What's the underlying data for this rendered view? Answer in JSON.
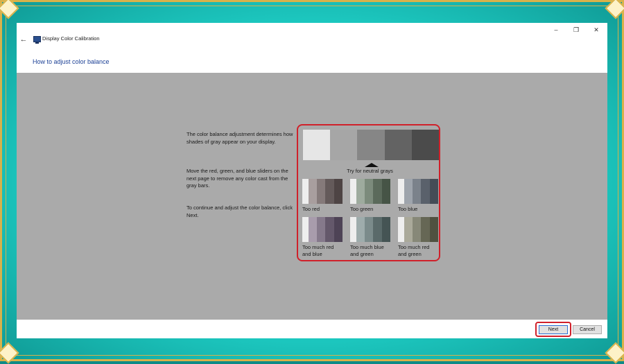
{
  "window": {
    "title": "Display Color Calibration",
    "back_icon": "back-arrow-icon",
    "controls": {
      "minimize": "–",
      "maximize": "❐",
      "close": "✕"
    }
  },
  "page": {
    "heading": "How to adjust color balance",
    "paragraphs": [
      "The color balance adjustment determines how shades of gray appear on your display.",
      "Move the red, green, and blue sliders on the next page to remove any color cast from the gray bars.",
      "To continue and adjust the color balance, click Next."
    ]
  },
  "samples": {
    "neutral_label": "Try for neutral grays",
    "neutral_colors": [
      "#e6e6e6",
      "#a6a6a6",
      "#868686",
      "#636363",
      "#4b4b4b"
    ],
    "items": [
      {
        "label": "Too red",
        "colors": [
          "#eeeeee",
          "#a89e9e",
          "#857a7a",
          "#645a5a",
          "#4e4444"
        ]
      },
      {
        "label": "Too green",
        "colors": [
          "#eeeeee",
          "#9eab9e",
          "#7c8b7c",
          "#5b6a5b",
          "#465446"
        ]
      },
      {
        "label": "Too blue",
        "colors": [
          "#eeeeee",
          "#9ea4ac",
          "#7b828b",
          "#5a616b",
          "#454c56"
        ]
      },
      {
        "label": "Too much red and blue",
        "colors": [
          "#eeeeee",
          "#a89cac",
          "#85798b",
          "#64586b",
          "#4e4356"
        ]
      },
      {
        "label": "Too much blue and green",
        "colors": [
          "#eeeeee",
          "#9eacac",
          "#7b8b8b",
          "#5a6a6a",
          "#455454"
        ]
      },
      {
        "label": "Too much red and green",
        "colors": [
          "#eeeeee",
          "#aaa99a",
          "#878878",
          "#666755",
          "#505140"
        ]
      }
    ]
  },
  "footer": {
    "next_label": "Next",
    "cancel_label": "Cancel"
  }
}
